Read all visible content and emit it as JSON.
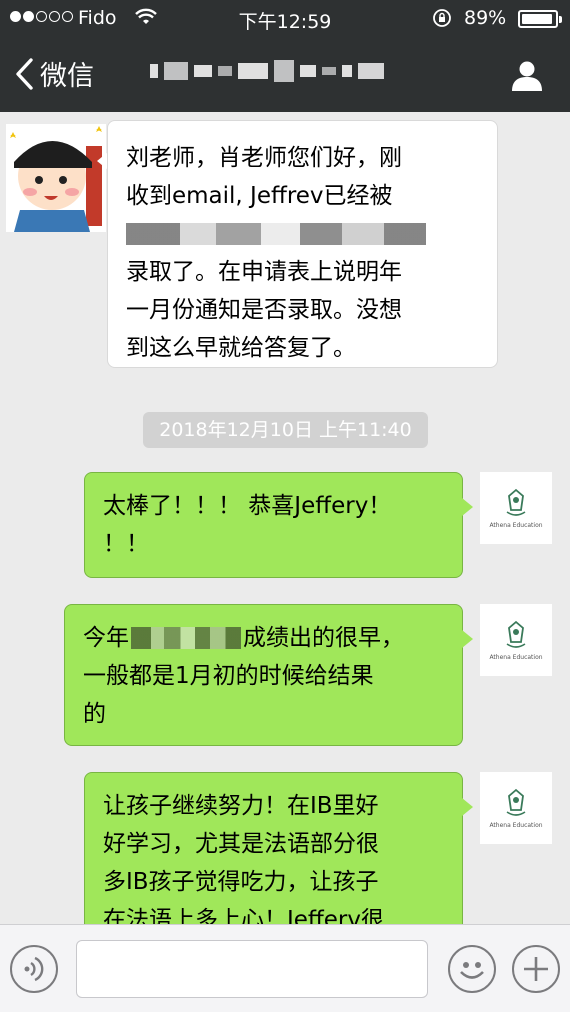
{
  "status": {
    "carrier": "Fido",
    "time": "下午12:59",
    "battery": "89%"
  },
  "nav": {
    "back_label": "微信"
  },
  "messages": [
    {
      "side": "left",
      "lines": [
        "刘老师，肖老师您们好，刚",
        "收到email, Jeffrev已经被",
        "",
        "录取了。在申请表上说明年",
        "一月份通知是否录取。没想",
        "到这么早就给答复了。"
      ]
    },
    {
      "side": "right",
      "lines": [
        "太棒了！！！ 恭喜Jeffery！",
        "！！"
      ]
    },
    {
      "side": "right",
      "prefix": "今年",
      "suffix": "成绩出的很早，",
      "lines": [
        "一般都是1月初的时候给结果",
        "的"
      ]
    },
    {
      "side": "right",
      "lines": [
        "让孩子继续努力！在IB里好",
        "好学习，尤其是法语部分很",
        "多IB孩子觉得吃力，让孩子",
        "在法语上多上心！Jefferv很"
      ]
    }
  ],
  "timestamp": "2018年12月10日  上午11:40",
  "athena_label": "Athena Education",
  "icons": {
    "back": "chevron-left-icon",
    "profile": "person-icon",
    "voice": "voice-icon",
    "emoji": "emoji-icon",
    "plus": "plus-icon"
  }
}
